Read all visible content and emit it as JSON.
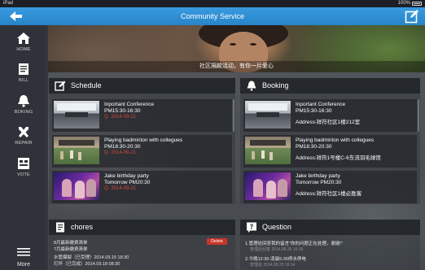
{
  "status_bar": {
    "device": "iPad",
    "battery": "100%"
  },
  "header": {
    "title": "Community  Service"
  },
  "sidebar": {
    "items": [
      {
        "label": "HOME",
        "icon": "home-icon"
      },
      {
        "label": "BILL",
        "icon": "bill-icon"
      },
      {
        "label": "BOKING",
        "icon": "bell-icon"
      },
      {
        "label": "REPAIR",
        "icon": "tools-icon"
      },
      {
        "label": "VOTE",
        "icon": "vote-icon"
      }
    ],
    "more_label": "More"
  },
  "banner": {
    "caption": "社区捐款活动，有你一片爱心"
  },
  "schedule": {
    "title": "Schedule",
    "items": [
      {
        "title": "Inportant Conference",
        "time": "PM15:30-16:30",
        "note": "Q· 2014-09-21"
      },
      {
        "title": "Playing badminton with collegues",
        "time": "PM18:30-20:30",
        "note": "Q· 2014-09-21"
      },
      {
        "title": "Jake birthday party",
        "time": "Tomorrow PM20:30",
        "note": "Q· 2014-09-21"
      }
    ]
  },
  "booking": {
    "title": "Booking",
    "items": [
      {
        "title": "Inportant Conference",
        "time": "PM15:30-16:30",
        "address": "Address:祥符社区1楼212室"
      },
      {
        "title": "Playing badminton with collegues",
        "time": "PM18:30-20:30",
        "address": "Address:祥符1号楼C-6东流羽毛球馆"
      },
      {
        "title": "Jake birthday party",
        "time": "Tomorrow PM20:30",
        "address": "Address:祥符社区1楼必胜客"
      }
    ]
  },
  "chores": {
    "title": "chores",
    "lines": [
      "8月最新缴费清单",
      "7月最新缴费清单",
      "水管爆裂（已受理）2014.09.15  18:30",
      "灯坏（已完成）2014.09.18 08:30"
    ],
    "delete_label": "Delete"
  },
  "question": {
    "title": "Question",
    "items": [
      {
        "text": "1.管理处回答我的留言“你的问题正在处理，谢谢!”",
        "sub": "管理处回答 2014.08.25 16:18"
      },
      {
        "text": "2.今晚12:30-凌晨5:30停水停电",
        "sub": "管理处 2014.08.25 16:14"
      }
    ]
  }
}
